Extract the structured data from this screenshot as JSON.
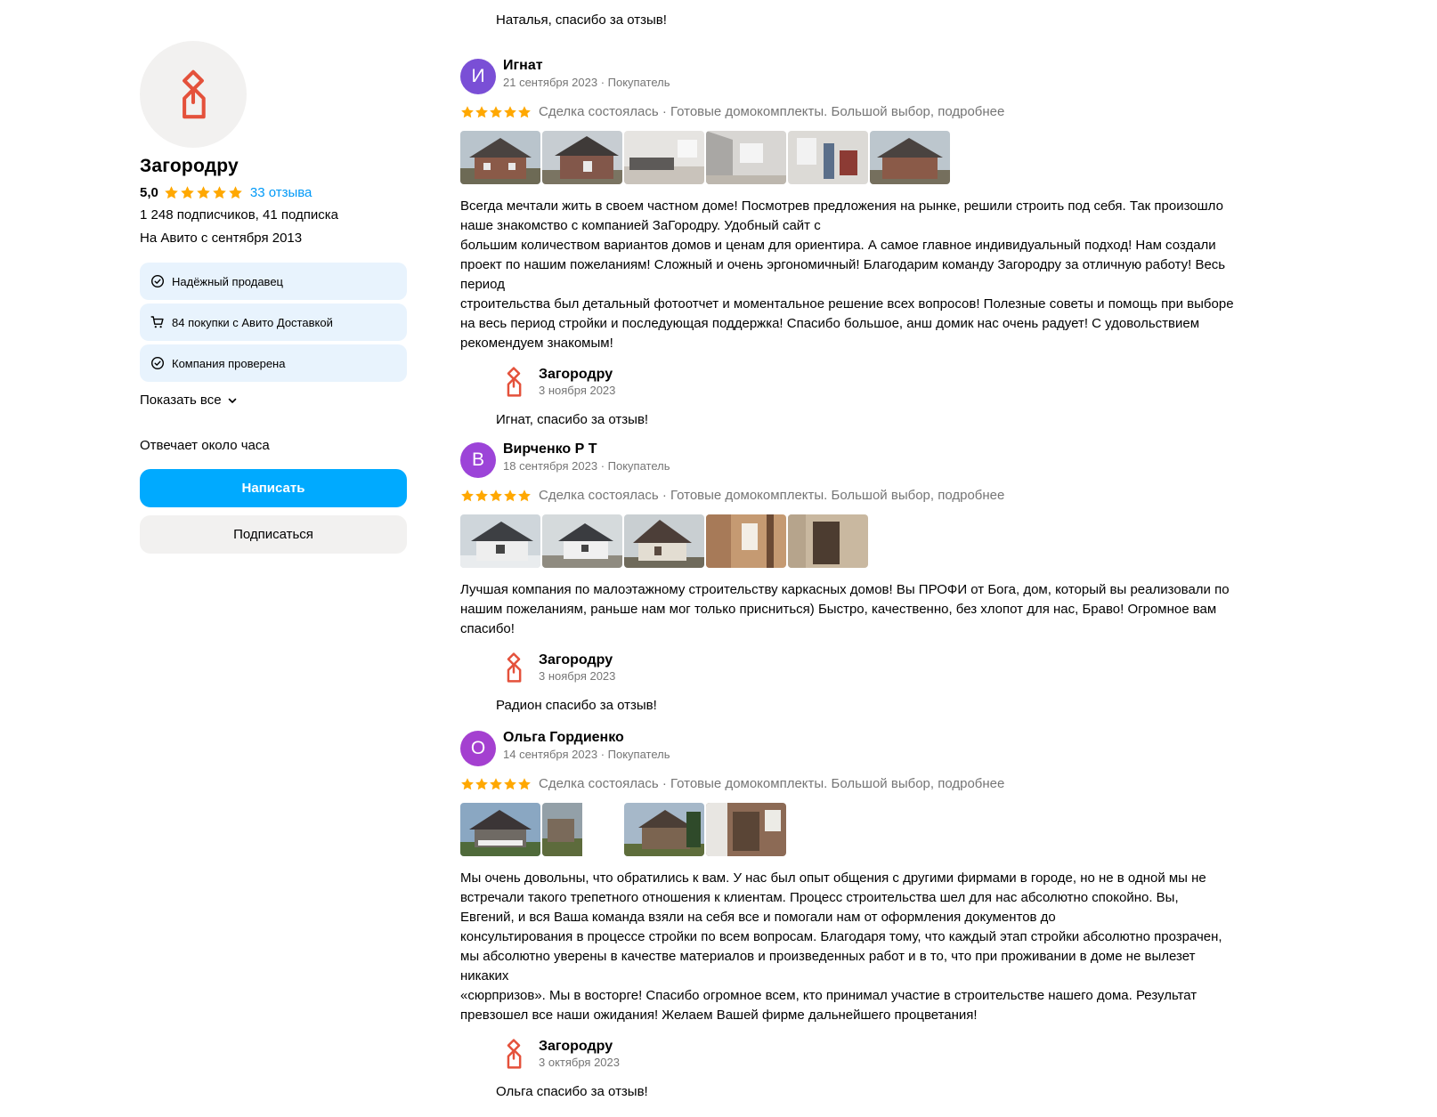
{
  "colors": {
    "accent_blue": "#00aaff",
    "link_blue": "#0099f7",
    "star_orange": "#ffa800",
    "logo_red": "#e4513b",
    "badge_bg": "#e8f3fd",
    "avatar_ignat": "#7a4fd6",
    "avatar_virchenko": "#9c44d8",
    "avatar_olga": "#a440d0"
  },
  "icons": {
    "shop_logo": "house-pin-logo-icon",
    "star": "star-icon",
    "badge_reliable": "check-circle-icon",
    "badge_delivery": "cart-icon",
    "badge_verified": "check-circle-icon",
    "show_all": "chevron-down-icon"
  },
  "seller": {
    "name": "Загородру",
    "rating": "5,0",
    "reviews_link": "33 отзыва",
    "followers": "1 248 подписчиков, 41 подписка",
    "since": "На Авито с сентября 2013",
    "badges": [
      {
        "label": "Надёжный продавец"
      },
      {
        "label": "84 покупки с Авито Доставкой"
      },
      {
        "label": "Компания проверена"
      }
    ],
    "show_all": "Показать все",
    "responds": "Отвечает около часа",
    "write_button": "Написать",
    "subscribe_button": "Подписаться"
  },
  "top_reply": {
    "text": "Наталья, спасибо за отзыв!"
  },
  "reviews": [
    {
      "initial": "И",
      "name": "Игнат",
      "sub": "21 сентября 2023 · Покупатель",
      "stars": 5,
      "deal": "Сделка состоялась · Готовые домокомплекты. Большой выбор, подробнее",
      "photo_count": 6,
      "text": "Всегда мечтали жить в своем частном доме! Посмотрев предложения на рынке, решили строить под себя. Так произошло\nнаше знакомство с компанией ЗаГородру. Удобный сайт с\nбольшим количеством вариантов домов и ценам для ориентира. А самое главное индивидуальный подход! Нам создали\nпроект по нашим пожеланиям! Сложный и очень эргономичный! Благодарим команду Загородру за отличную работу! Весь\nпериод\nстроительства был детальный фотоотчет и моментальное решение всех вопросов! Полезные советы и помощь при выборе\nна весь период стройки и последующая поддержка! Спасибо большое, анш домик нас очень радует! С удовольствием\nрекомендуем знакомым!",
      "reply": {
        "name": "Загородру",
        "date": "3 ноября 2023",
        "text": "Игнат, спасибо за отзыв!"
      }
    },
    {
      "initial": "В",
      "name": "Вирченко Р Т",
      "sub": "18 сентября 2023 · Покупатель",
      "stars": 5,
      "deal": "Сделка состоялась · Готовые домокомплекты. Большой выбор, подробнее",
      "photo_count": 5,
      "text": "Лучшая компания по малоэтажному строительству каркасных домов! Вы ПРОФИ от Бога, дом, который вы реализовали по\nнашим пожеланиям, раньше нам мог только присниться) Быстро, качественно, без хлопот для нас, Браво! Огромное вам\nспасибо!",
      "reply": {
        "name": "Загородру",
        "date": "3 ноября 2023",
        "text": "Радион спасибо за отзыв!"
      }
    },
    {
      "initial": "О",
      "name": "Ольга Гордиенко",
      "sub": "14 сентября 2023 · Покупатель",
      "stars": 5,
      "deal": "Сделка состоялась · Готовые домокомплекты. Большой выбор, подробнее",
      "photo_count": 4,
      "text": "Мы очень довольны, что обратились к вам. У нас был опыт общения с другими фирмами в городе, но не в одной мы не\nвстречали такого трепетного отношения к клиентам. Процесс строительства шел для нас абсолютно спокойно. Вы,\nЕвгений, и вся Ваша команда взяли на себя все и помогали нам от оформления документов до\nконсультирования в процессе стройки по всем вопросам. Благодаря тому, что каждый этап стройки абсолютно прозрачен,\nмы абсолютно уверены в качестве материалов и произведенных работ и в то, что при проживании в доме не вылезет\nникаких\n«сюрпризов». Мы в восторге! Спасибо огромное всем, кто принимал участие в строительстве нашего дома. Результат\nпревзошел все наши ожидания! Желаем Вашей фирме дальнейшего процветания!",
      "reply": {
        "name": "Загородру",
        "date": "3 октября 2023",
        "text": "Ольга спасибо за отзыв!"
      }
    }
  ]
}
